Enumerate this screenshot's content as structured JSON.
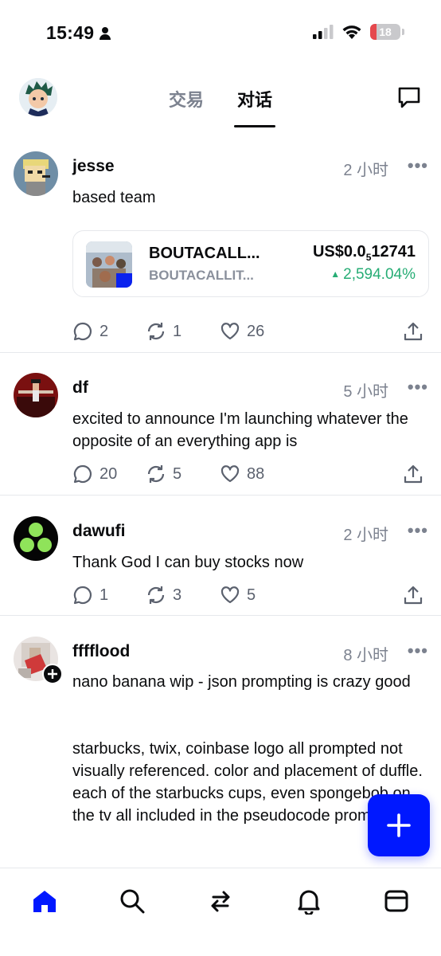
{
  "status_bar": {
    "time": "15:49",
    "battery": "18"
  },
  "header": {
    "tabs": [
      {
        "label": "交易",
        "active": false
      },
      {
        "label": "对话",
        "active": true
      }
    ]
  },
  "posts": [
    {
      "username": "jesse",
      "time": "2 小时",
      "text": "based team",
      "token": {
        "name": "BOUTACALL...",
        "ticker": "BOUTACALLIT...",
        "price_prefix": "US$0.0",
        "price_sub": "5",
        "price_rest": "12741",
        "change": "2,594.04%"
      },
      "comments": "2",
      "reposts": "1",
      "likes": "26"
    },
    {
      "username": "df",
      "time": "5 小时",
      "text": "excited to announce I'm launching whatever the opposite of an everything app is",
      "comments": "20",
      "reposts": "5",
      "likes": "88"
    },
    {
      "username": "dawufi",
      "time": "2 小时",
      "text": "Thank God I can buy stocks now",
      "comments": "1",
      "reposts": "3",
      "likes": "5"
    },
    {
      "username": "fffflood",
      "time": "8 小时",
      "text_line1": "nano banana wip - json prompting is crazy good",
      "text_line2": "starbucks, twix, coinbase logo all prompted not visually referenced. color and placement of duffle. each of the starbucks cups, even spongebob on the tv all included in the pseudocode prompt."
    }
  ],
  "more_label": "•••",
  "colors": {
    "accent": "#0018ff",
    "positive": "#27ad75",
    "muted": "#7c828f"
  },
  "nav": [
    "home-icon",
    "search-icon",
    "swap-icon",
    "bell-icon",
    "browser-icon"
  ]
}
